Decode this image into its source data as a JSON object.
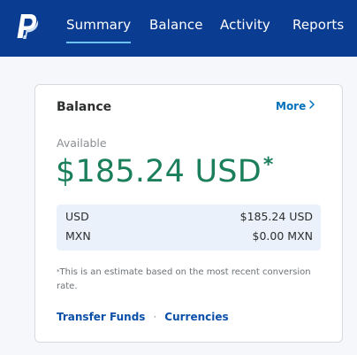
{
  "brand": {
    "logo_icon": "paypal-logo-icon",
    "colors": {
      "header": "#0a3c91",
      "accent": "#1a7f5a",
      "link": "#0a4fa8"
    }
  },
  "nav": {
    "items": [
      {
        "label": "Summary",
        "active": true
      },
      {
        "label": "Balance"
      },
      {
        "label": "Activity"
      },
      {
        "label": "Reports"
      }
    ]
  },
  "balance_card": {
    "title": "Balance",
    "more_label": "More",
    "more_icon": "chevron-right-icon",
    "available_label": "Available",
    "amount": "$185.24 USD",
    "amount_marker": "*",
    "currencies": [
      {
        "code": "USD",
        "value": "$185.24 USD"
      },
      {
        "code": "MXN",
        "value": "$0.00 MXN"
      }
    ],
    "disclaimer_marker": "*",
    "disclaimer": "This is an estimate based on the most recent conversion rate.",
    "links": {
      "transfer": "Transfer Funds",
      "separator": "·",
      "currencies": "Currencies"
    }
  }
}
